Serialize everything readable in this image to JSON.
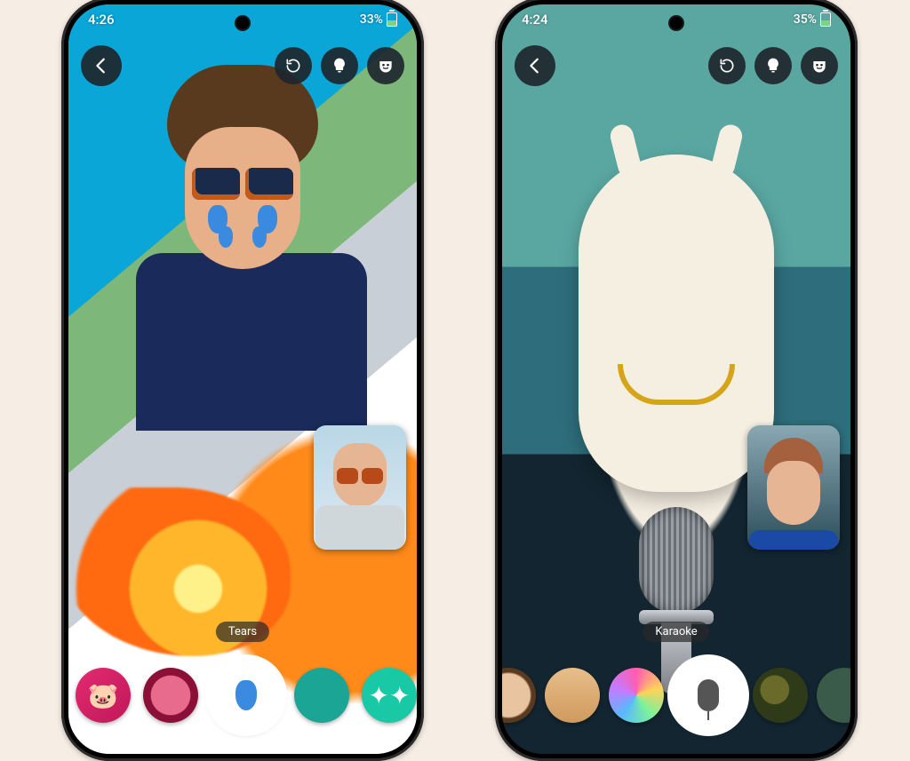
{
  "phones": {
    "left": {
      "status": {
        "time": "4:26",
        "battery_pct": "33%"
      },
      "topbar": {
        "back": "back-icon",
        "actions": [
          "history-icon",
          "lightbulb-icon",
          "mask-icon"
        ]
      },
      "selected_effect_label": "Tears",
      "effects": [
        {
          "name": "pig-effect",
          "label": "Pig"
        },
        {
          "name": "ring-effect",
          "label": "Ring"
        },
        {
          "name": "tears-effect",
          "label": "Tears",
          "selected": true
        },
        {
          "name": "blur-effect",
          "label": "Teal blur"
        },
        {
          "name": "sparkle-effect",
          "label": "Sparkle"
        }
      ]
    },
    "right": {
      "status": {
        "time": "4:24",
        "battery_pct": "35%"
      },
      "topbar": {
        "back": "back-icon",
        "actions": [
          "history-icon",
          "lightbulb-icon",
          "mask-icon"
        ]
      },
      "selected_effect_label": "Karaoke",
      "effects": [
        {
          "name": "avatar-effect",
          "label": "Avatar"
        },
        {
          "name": "caricature-effect",
          "label": "Face"
        },
        {
          "name": "rainbow-effect",
          "label": "Rainbow"
        },
        {
          "name": "karaoke-effect",
          "label": "Karaoke",
          "selected": true
        },
        {
          "name": "camo-effect",
          "label": "Camo"
        },
        {
          "name": "forest-effect",
          "label": "Forest"
        }
      ]
    }
  },
  "colors": {
    "chip_bg": "rgba(40,40,40,.7)",
    "circ_btn_bg": "rgba(30,38,44,.92)"
  }
}
